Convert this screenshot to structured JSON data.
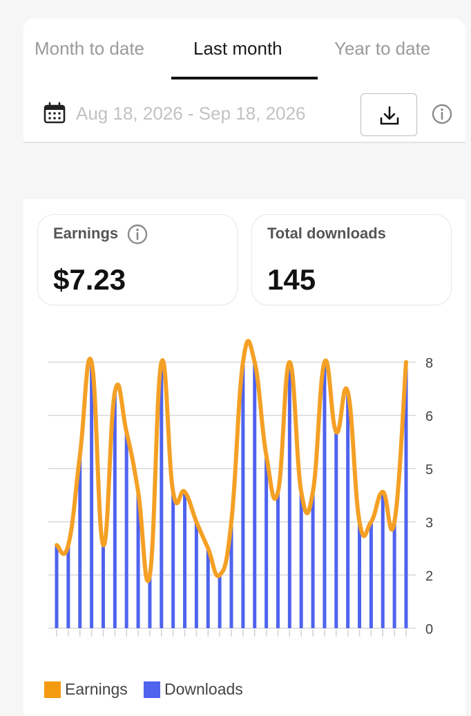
{
  "tabs": [
    {
      "label": "Month to date",
      "active": false
    },
    {
      "label": "Last month",
      "active": true
    },
    {
      "label": "Year to date",
      "active": false
    }
  ],
  "date_range": "Aug 18, 2026 - Sep 18, 2026",
  "icons": {
    "calendar": "calendar-icon",
    "download": "download-icon",
    "info": "info-icon"
  },
  "stats": {
    "earnings": {
      "label": "Earnings",
      "value": "$7.23"
    },
    "downloads": {
      "label": "Total downloads",
      "value": "145"
    }
  },
  "colors": {
    "earnings": "#f4a025",
    "downloads": "#4f63ee",
    "legend_earnings": "#f49a10",
    "legend_downloads": "#4f63ee",
    "grid": "#e2e2e2",
    "axis_text": "#444444"
  },
  "chart_data": {
    "type": "bar",
    "y_axis_position": "right",
    "y_ticks": [
      "8",
      "6",
      "5",
      "3",
      "2",
      "0"
    ],
    "ylim": [
      0,
      8
    ],
    "grid": true,
    "legend_placement": "bottom-left",
    "series": [
      {
        "name": "Earnings",
        "type": "line",
        "values": [
          2.5,
          2.5,
          5.2,
          8.0,
          2.5,
          7.1,
          5.9,
          4.1,
          1.6,
          8.0,
          4.1,
          4.1,
          3.2,
          2.4,
          1.6,
          3.2,
          8.0,
          8.0,
          5.2,
          4.1,
          8.0,
          4.1,
          4.1,
          8.0,
          5.9,
          7.1,
          3.2,
          3.2,
          4.1,
          3.2,
          8.0
        ]
      },
      {
        "name": "Downloads",
        "type": "bar",
        "values": [
          2.5,
          2.5,
          5.2,
          8.0,
          2.5,
          7.1,
          5.9,
          4.1,
          1.6,
          8.0,
          4.1,
          4.1,
          3.2,
          2.4,
          1.6,
          3.2,
          8.0,
          8.0,
          5.2,
          4.1,
          8.0,
          4.1,
          4.1,
          8.0,
          5.9,
          7.1,
          3.2,
          3.2,
          4.1,
          3.2,
          8.0
        ]
      }
    ]
  }
}
